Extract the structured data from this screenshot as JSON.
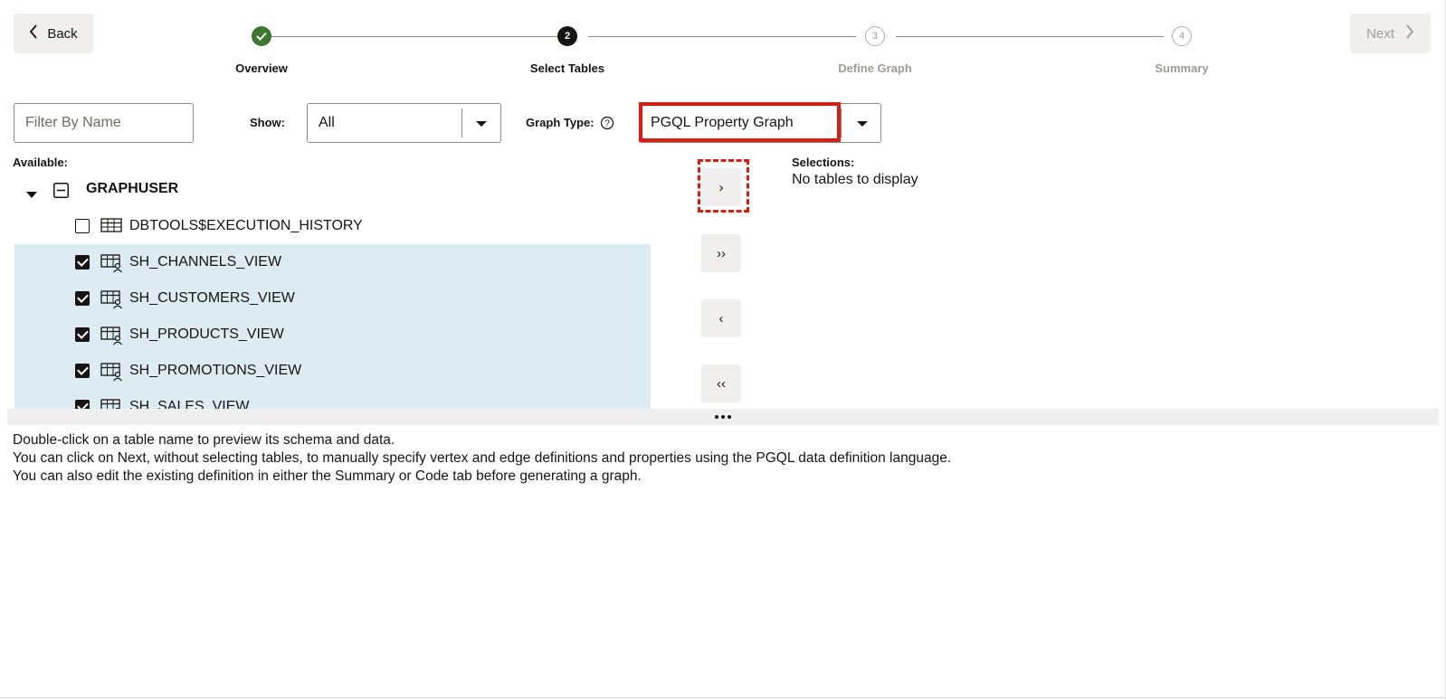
{
  "header": {
    "back_label": "Back",
    "next_label": "Next",
    "steps": [
      {
        "number": "1",
        "label": "Overview",
        "state": "done"
      },
      {
        "number": "2",
        "label": "Select Tables",
        "state": "current"
      },
      {
        "number": "3",
        "label": "Define Graph",
        "state": "todo"
      },
      {
        "number": "4",
        "label": "Summary",
        "state": "todo"
      }
    ]
  },
  "filters": {
    "filter_placeholder": "Filter By Name",
    "show_label": "Show:",
    "show_value": "All",
    "graph_type_label": "Graph Type:",
    "graph_type_value": "PGQL Property Graph"
  },
  "available": {
    "label": "Available:",
    "schema": "GRAPHUSER",
    "rows": [
      {
        "name": "DBTOOLS$EXECUTION_HISTORY",
        "checked": false,
        "kind": "table"
      },
      {
        "name": "SH_CHANNELS_VIEW",
        "checked": true,
        "kind": "view"
      },
      {
        "name": "SH_CUSTOMERS_VIEW",
        "checked": true,
        "kind": "view"
      },
      {
        "name": "SH_PRODUCTS_VIEW",
        "checked": true,
        "kind": "view"
      },
      {
        "name": "SH_PROMOTIONS_VIEW",
        "checked": true,
        "kind": "view"
      },
      {
        "name": "SH_SALES_VIEW",
        "checked": true,
        "kind": "view"
      }
    ]
  },
  "shuttle": {
    "move_selected": "›",
    "move_all": "››",
    "remove_selected": "‹",
    "remove_all": "‹‹"
  },
  "selections": {
    "label": "Selections:",
    "empty_text": "No tables to display"
  },
  "help": {
    "lines": [
      "Double-click on a table name to preview its schema and data.",
      "You can click on Next, without selecting tables, to manually specify vertex and edge definitions and properties using the PGQL data definition language.",
      "You can also edit the existing definition in either the Summary or Code tab before generating a graph."
    ]
  },
  "colors": {
    "done_step": "#3d7831",
    "selected_row": "#dcecf2",
    "highlight": "#e1190e",
    "button_bg": "#f1efed"
  }
}
